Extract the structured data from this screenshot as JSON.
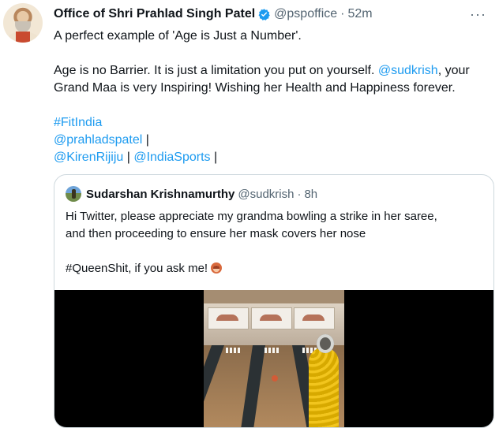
{
  "tweet": {
    "author_name": "Office of Shri Prahlad Singh Patel",
    "handle": "@pspoffice",
    "separator": "·",
    "time": "52m",
    "more_label": "···",
    "text_line1": "A perfect example of 'Age is Just a Number'.",
    "text_line2_a": "Age is no Barrier. It is just a limitation you put on yourself. ",
    "mention_sudkrish": "@sudkrish",
    "text_line2_b": ", your",
    "text_line3": "Grand Maa is very Inspiring! Wishing her Health and Happiness forever.",
    "hashtag": "#FitIndia",
    "mention_prahlad": "@prahladspatel",
    "mention_kiren": "@KirenRijiju",
    "mention_sports": "@IndiaSports",
    "pipe": " |"
  },
  "quote": {
    "author_name": "Sudarshan Krishnamurthy",
    "handle": "@sudkrish",
    "separator": "·",
    "time": "8h",
    "text_line1": "Hi Twitter, please appreciate my grandma bowling a strike in her saree,",
    "text_line2": "and then proceeding to ensure her mask covers her nose",
    "text_line3": "#QueenShit, if you ask me!",
    "emoji_icon": "woman-emoji"
  },
  "colors": {
    "link": "#1d9bf0",
    "text": "#0f1419",
    "secondary": "#536471",
    "border": "#cfd9de"
  }
}
